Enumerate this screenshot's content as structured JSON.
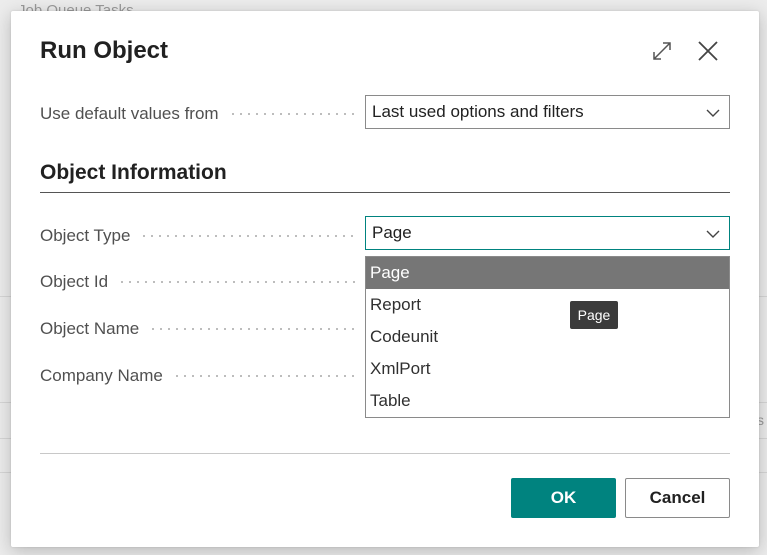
{
  "background": {
    "page_title": "Job Queue Tasks",
    "edge_text": "s"
  },
  "dialog": {
    "title": "Run Object",
    "expand_icon": "expand-icon",
    "close_icon": "close-icon"
  },
  "defaults": {
    "label": "Use default values from",
    "value": "Last used options and filters"
  },
  "section": {
    "title": "Object Information"
  },
  "fields": {
    "object_type": {
      "label": "Object Type",
      "value": "Page"
    },
    "object_id": {
      "label": "Object Id"
    },
    "object_name": {
      "label": "Object Name"
    },
    "company_name": {
      "label": "Company Name"
    }
  },
  "dropdown": {
    "options": [
      "Page",
      "Report",
      "Codeunit",
      "XmlPort",
      "Table"
    ],
    "selected": "Page"
  },
  "tooltip": {
    "text": "Page"
  },
  "buttons": {
    "ok": "OK",
    "cancel": "Cancel"
  },
  "colors": {
    "accent": "#00837f",
    "selected_row": "#767676",
    "tooltip_bg": "#3b3b3b"
  }
}
